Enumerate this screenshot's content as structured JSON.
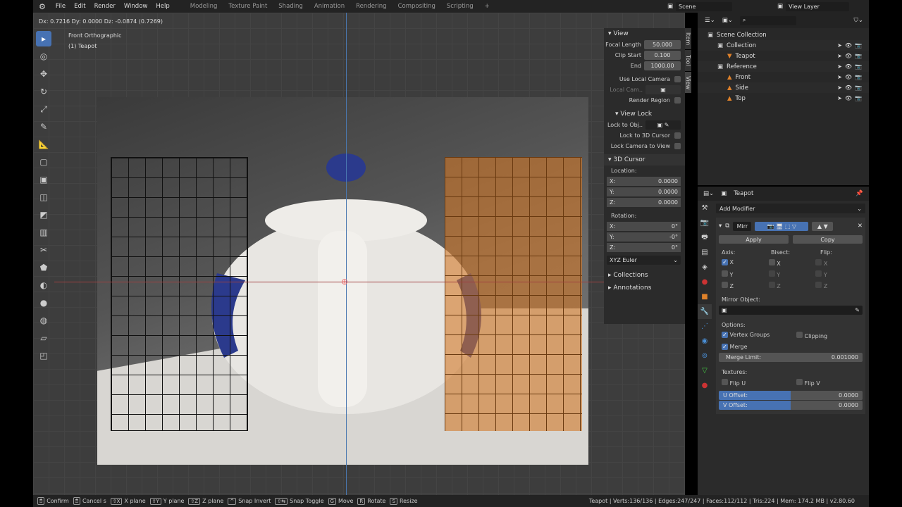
{
  "topbar": {
    "menus": [
      "File",
      "Edit",
      "Render",
      "Window",
      "Help"
    ],
    "workspaces": [
      "Modeling",
      "Texture Paint",
      "Shading",
      "Animation",
      "Rendering",
      "Compositing",
      "Scripting",
      "+"
    ],
    "scene": "Scene",
    "view_layer": "View Layer"
  },
  "viewport": {
    "header_info": "Dx: 0.7216  Dy: 0.0000  Dz: -0.0874 (0.7269)",
    "view_name": "Front Orthographic",
    "object_name": "(1) Teapot"
  },
  "sidebar": {
    "tabs": [
      "Item",
      "Tool",
      "View"
    ],
    "view_panel": "View",
    "focal_length_label": "Focal Length",
    "focal_length": "50.000",
    "clip_start_label": "Clip Start",
    "clip_start": "0.100",
    "end_label": "End",
    "end": "1000.00",
    "use_local_camera": "Use Local Camera",
    "local_camera": "Local Cam..",
    "render_region": "Render Region",
    "view_lock": "View Lock",
    "lock_to_obj": "Lock to Obj..",
    "lock_3d_cursor": "Lock to 3D Cursor",
    "lock_camera": "Lock Camera to View",
    "cursor_panel": "3D Cursor",
    "location": "Location:",
    "loc": [
      {
        "a": "X:",
        "v": "0.0000"
      },
      {
        "a": "Y:",
        "v": "0.0000"
      },
      {
        "a": "Z:",
        "v": "0.0000"
      }
    ],
    "rotation": "Rotation:",
    "rot": [
      {
        "a": "X:",
        "v": "0°"
      },
      {
        "a": "Y:",
        "v": "-0°"
      },
      {
        "a": "Z:",
        "v": "0°"
      }
    ],
    "rotation_mode": "XYZ Euler",
    "collections": "Collections",
    "annotations": "Annotations"
  },
  "outliner": {
    "rows": [
      {
        "label": "Scene Collection",
        "indent": 0
      },
      {
        "label": "Collection",
        "indent": 1
      },
      {
        "label": "Teapot",
        "indent": 2
      },
      {
        "label": "Reference",
        "indent": 1
      },
      {
        "label": "Front",
        "indent": 2
      },
      {
        "label": "Side",
        "indent": 2
      },
      {
        "label": "Top",
        "indent": 2
      }
    ]
  },
  "properties": {
    "object": "Teapot",
    "add_modifier": "Add Modifier",
    "modifier_name": "Mirr",
    "apply": "Apply",
    "copy": "Copy",
    "axis": "Axis:",
    "bisect": "Bisect:",
    "flip": "Flip:",
    "axes": [
      "X",
      "Y",
      "Z"
    ],
    "axis_checked": [
      true,
      false,
      false
    ],
    "mirror_object": "Mirror Object:",
    "options": "Options:",
    "vertex_groups": "Vertex Groups",
    "clipping": "Clipping",
    "merge": "Merge",
    "merge_limit_label": "Merge Limit:",
    "merge_limit": "0.001000",
    "textures": "Textures:",
    "flip_u": "Flip U",
    "flip_v": "Flip V",
    "u_offset_label": "U Offset:",
    "u_offset": "0.0000",
    "v_offset_label": "V Offset:",
    "v_offset": "0.0000"
  },
  "statusbar": {
    "items": [
      {
        "k": "🖱",
        "l": "Confirm"
      },
      {
        "k": "🖱",
        "l": "Cancel s"
      },
      {
        "k": "⇧X",
        "l": "X plane"
      },
      {
        "k": "⇧Y",
        "l": "Y plane"
      },
      {
        "k": "⇧Z",
        "l": "Z plane"
      },
      {
        "k": "^",
        "l": "Snap Invert"
      },
      {
        "k": "⇧⇆",
        "l": "Snap Toggle"
      },
      {
        "k": "G",
        "l": "Move"
      },
      {
        "k": "R",
        "l": "Rotate"
      },
      {
        "k": "S",
        "l": "Resize"
      }
    ],
    "stats": "Teapot | Verts:136/136 | Edges:247/247 | Faces:112/112 | Tris:224 | Mem: 174.2 MB | v2.80.60"
  },
  "colors": {
    "accent": "#4772b3",
    "orange": "#e0822a"
  }
}
